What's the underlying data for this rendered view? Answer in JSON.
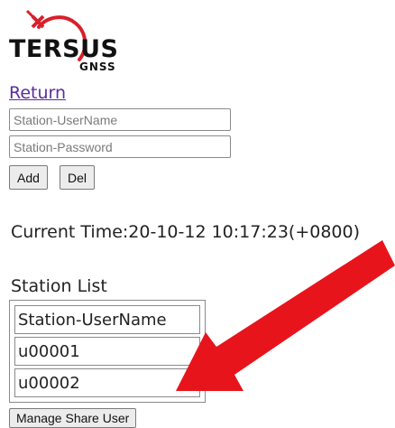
{
  "logo": {
    "brand": "TERSUS",
    "sub": "GNSS"
  },
  "nav": {
    "return_label": "Return"
  },
  "form": {
    "username_placeholder": "Station-UserName",
    "password_placeholder": "Station-Password",
    "add_label": "Add",
    "del_label": "Del"
  },
  "status": {
    "current_time": "Current Time:20-10-12 10:17:23(+0800)"
  },
  "station_list": {
    "title": "Station List",
    "header": "Station-UserName",
    "rows": [
      "u00001",
      "u00002"
    ]
  },
  "actions": {
    "manage_share_label": "Manage Share User"
  },
  "colors": {
    "link": "#5b2d9e",
    "logo_red": "#d8202a",
    "annotation_arrow": "#e8141c"
  },
  "annotation": {
    "icon": "red-arrow-icon"
  }
}
